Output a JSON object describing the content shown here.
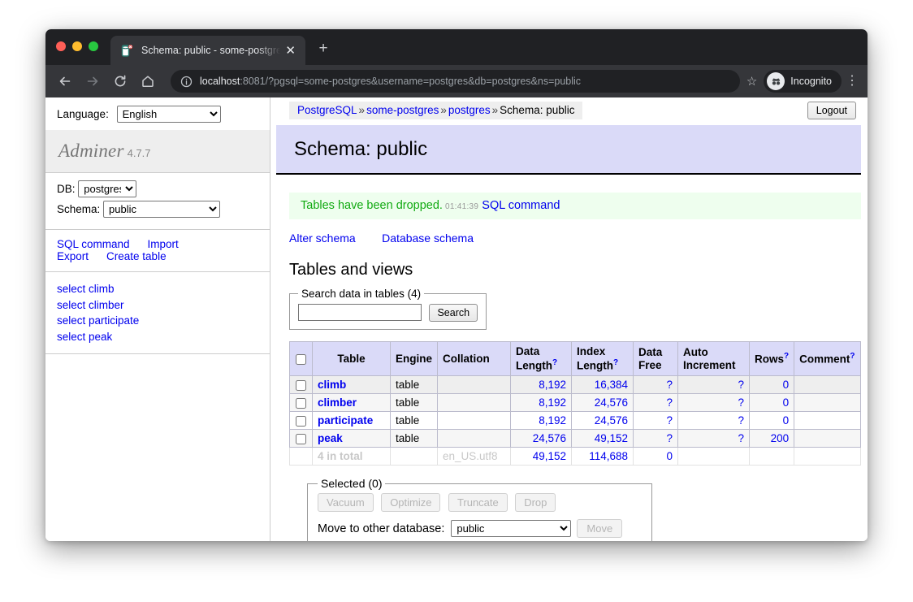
{
  "browser": {
    "tab_title": "Schema: public - some-postgres",
    "tab_close_glyph": "✕",
    "new_tab_glyph": "+",
    "url_host": "localhost",
    "url_rest": ":8081/?pgsql=some-postgres&username=postgres&db=postgres&ns=public",
    "star_glyph": "☆",
    "incognito_label": "Incognito",
    "menu_glyph": "⋮"
  },
  "sidebar": {
    "language_label": "Language:",
    "language_value": "English",
    "brand_name": "Adminer",
    "brand_version": "4.7.7",
    "db_label": "DB:",
    "db_value": "postgres",
    "schema_label": "Schema:",
    "schema_value": "public",
    "action_links": [
      "SQL command",
      "Import",
      "Export",
      "Create table"
    ],
    "select_links": [
      "select climb",
      "select climber",
      "select participate",
      "select peak"
    ]
  },
  "header": {
    "breadcrumb": [
      "PostgreSQL",
      "some-postgres",
      "postgres"
    ],
    "breadcrumb_separator": "»",
    "breadcrumb_current": "Schema: public",
    "logout_label": "Logout",
    "page_title": "Schema: public"
  },
  "message": {
    "text": "Tables have been dropped.",
    "time": "01:41:39",
    "link": "SQL command"
  },
  "schema_links": [
    "Alter schema",
    "Database schema"
  ],
  "tables_section": {
    "heading": "Tables and views",
    "search_legend": "Search data in tables (4)",
    "search_value": "",
    "search_placeholder": "",
    "search_button": "Search"
  },
  "table": {
    "columns": [
      {
        "label": "Table",
        "help": ""
      },
      {
        "label": "Engine",
        "help": ""
      },
      {
        "label": "Collation",
        "help": ""
      },
      {
        "label": "Data Length",
        "help": "?"
      },
      {
        "label": "Index Length",
        "help": "?"
      },
      {
        "label": "Data Free",
        "help": ""
      },
      {
        "label": "Auto Increment",
        "help": ""
      },
      {
        "label": "Rows",
        "help": "?"
      },
      {
        "label": "Comment",
        "help": "?"
      }
    ],
    "rows": [
      {
        "name": "climb",
        "engine": "table",
        "collation": "",
        "data_length": "8,192",
        "index_length": "16,384",
        "data_free": "?",
        "auto_increment": "?",
        "rows": "0",
        "comment": ""
      },
      {
        "name": "climber",
        "engine": "table",
        "collation": "",
        "data_length": "8,192",
        "index_length": "24,576",
        "data_free": "?",
        "auto_increment": "?",
        "rows": "0",
        "comment": ""
      },
      {
        "name": "participate",
        "engine": "table",
        "collation": "",
        "data_length": "8,192",
        "index_length": "24,576",
        "data_free": "?",
        "auto_increment": "?",
        "rows": "0",
        "comment": ""
      },
      {
        "name": "peak",
        "engine": "table",
        "collation": "",
        "data_length": "24,576",
        "index_length": "49,152",
        "data_free": "?",
        "auto_increment": "?",
        "rows": "200",
        "comment": ""
      }
    ],
    "total": {
      "label": "4 in total",
      "engine": "",
      "collation": "en_US.utf8",
      "data_length": "49,152",
      "index_length": "114,688",
      "data_free": "0",
      "auto_increment": "",
      "rows": "",
      "comment": ""
    }
  },
  "selected": {
    "legend": "Selected (0)",
    "buttons": [
      "Vacuum",
      "Optimize",
      "Truncate",
      "Drop"
    ],
    "move_label": "Move to other database:",
    "move_value": "public",
    "move_button": "Move"
  }
}
